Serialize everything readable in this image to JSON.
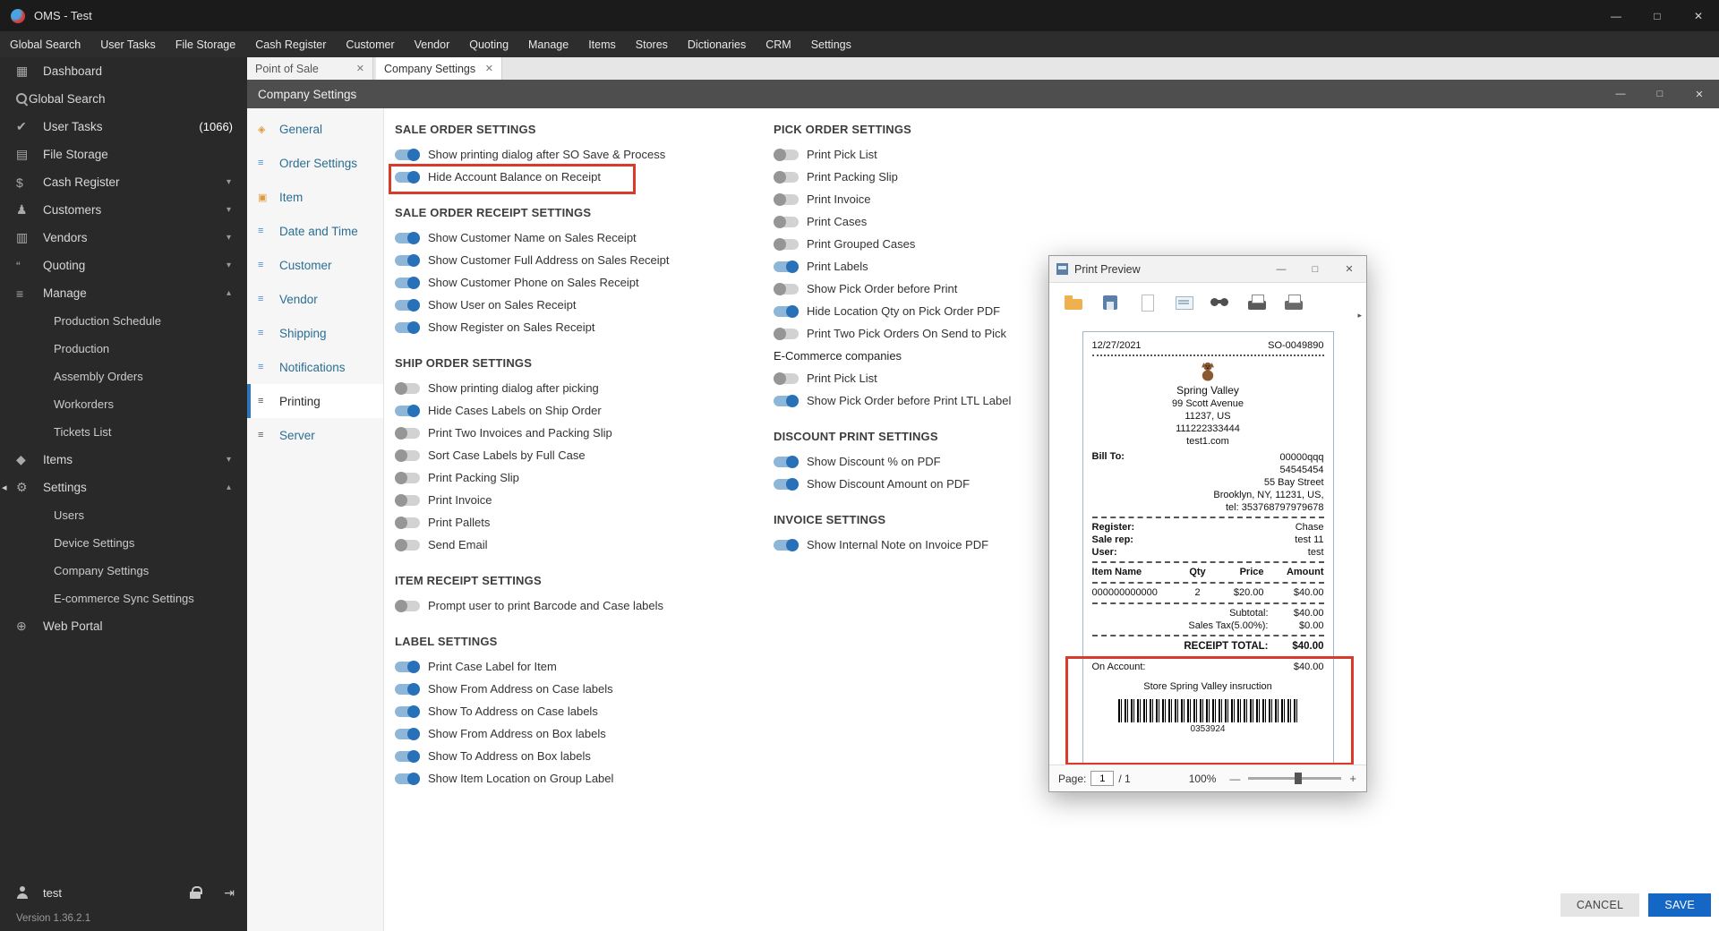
{
  "colors": {
    "accent_blue": "#2e75b6",
    "toggle_on_track": "#8db6d8",
    "toggle_on_knob": "#2871b8",
    "toggle_off_track": "#d2d2d2",
    "toggle_off_knob": "#969696",
    "annotation_red": "#d83a2b",
    "save_button_blue": "#1467c5"
  },
  "glyphs": {
    "minimize": "—",
    "maximize": "□",
    "close": "✕",
    "chevron_down": "▾",
    "chevron_up": "▴",
    "marker_left": "◂",
    "overflow": "▸",
    "logout": "⇥"
  },
  "titlebar": {
    "title": "OMS - Test"
  },
  "menubar": {
    "items": [
      "Global Search",
      "User Tasks",
      "File Storage",
      "Cash Register",
      "Customer",
      "Vendor",
      "Quoting",
      "Manage",
      "Items",
      "Stores",
      "Dictionaries",
      "CRM",
      "Settings"
    ]
  },
  "sidebar": {
    "items": [
      {
        "label": "Dashboard",
        "icon": "dashboard-icon",
        "glyph": "▦"
      },
      {
        "label": "Global Search",
        "icon": "search-icon",
        "glyph": "mag"
      },
      {
        "label": "User Tasks",
        "icon": "tasks-icon",
        "glyph": "✔",
        "count": "(1066)"
      },
      {
        "label": "File Storage",
        "icon": "file-storage-icon",
        "glyph": "▤"
      },
      {
        "label": "Cash Register",
        "icon": "cash-register-icon",
        "glyph": "$",
        "chevron": "down"
      },
      {
        "label": "Customers",
        "icon": "customers-icon",
        "glyph": "♟",
        "chevron": "down"
      },
      {
        "label": "Vendors",
        "icon": "vendors-icon",
        "glyph": "▥",
        "chevron": "down"
      },
      {
        "label": "Quoting",
        "icon": "quoting-icon",
        "glyph": "“",
        "chevron": "down"
      },
      {
        "label": "Manage",
        "icon": "manage-icon",
        "glyph": "≡",
        "chevron": "up"
      },
      {
        "label": "Production Schedule",
        "sub": true
      },
      {
        "label": "Production",
        "sub": true
      },
      {
        "label": "Assembly Orders",
        "sub": true
      },
      {
        "label": "Workorders",
        "sub": true
      },
      {
        "label": "Tickets List",
        "sub": true
      },
      {
        "label": "Items",
        "icon": "items-icon",
        "glyph": "◆",
        "chevron": "down"
      },
      {
        "label": "Settings",
        "icon": "gear-icon",
        "glyph": "⚙",
        "chevron": "up",
        "marker": true
      },
      {
        "label": "Users",
        "sub": true
      },
      {
        "label": "Device Settings",
        "sub": true
      },
      {
        "label": "Company Settings",
        "sub": true
      },
      {
        "label": "E-commerce Sync Settings",
        "sub": true
      },
      {
        "label": "Web Portal",
        "icon": "web-portal-icon",
        "glyph": "⊕"
      }
    ],
    "user": "test",
    "version": "Version 1.36.2.1"
  },
  "tabs": [
    {
      "label": "Point of Sale"
    },
    {
      "label": "Company Settings",
      "active": true
    }
  ],
  "settings_window": {
    "title": "Company Settings"
  },
  "settings_nav": [
    {
      "label": "General",
      "glyph": "◈",
      "color": "#e09a3e"
    },
    {
      "label": "Order Settings",
      "glyph": "≡",
      "color": "#4a90d9"
    },
    {
      "label": "Item",
      "glyph": "▣",
      "color": "#e09a3e"
    },
    {
      "label": "Date and Time",
      "glyph": "≡",
      "color": "#4a90d9"
    },
    {
      "label": "Customer",
      "glyph": "≡",
      "color": "#4a90d9"
    },
    {
      "label": "Vendor",
      "glyph": "≡",
      "color": "#4a90d9"
    },
    {
      "label": "Shipping",
      "glyph": "≡",
      "color": "#4a90d9"
    },
    {
      "label": "Notifications",
      "glyph": "≡",
      "color": "#4a90d9"
    },
    {
      "label": "Printing",
      "glyph": "≡",
      "color": "#555555",
      "selected": true
    },
    {
      "label": "Server",
      "glyph": "≡",
      "color": "#555555"
    }
  ],
  "settings_columns": [
    {
      "sections": [
        {
          "title": "SALE ORDER SETTINGS",
          "items": [
            {
              "label": "Show printing dialog after SO Save & Process",
              "on": true
            },
            {
              "label": "Hide Account Balance on Receipt",
              "on": true,
              "highlight": true
            }
          ]
        },
        {
          "title": "SALE ORDER RECEIPT SETTINGS",
          "items": [
            {
              "label": "Show Customer Name on Sales Receipt",
              "on": true
            },
            {
              "label": "Show Customer Full Address on Sales Receipt",
              "on": true
            },
            {
              "label": "Show Customer Phone on Sales Receipt",
              "on": true
            },
            {
              "label": "Show User on Sales Receipt",
              "on": true
            },
            {
              "label": "Show Register on Sales Receipt",
              "on": true
            }
          ]
        },
        {
          "title": "SHIP ORDER SETTINGS",
          "items": [
            {
              "label": "Show printing dialog after picking",
              "on": false
            },
            {
              "label": "Hide Cases Labels on Ship Order",
              "on": true
            },
            {
              "label": "Print Two Invoices and Packing Slip",
              "on": false
            },
            {
              "label": "Sort Case Labels by Full Case",
              "on": false
            },
            {
              "label": "Print Packing Slip",
              "on": false
            },
            {
              "label": "Print Invoice",
              "on": false
            },
            {
              "label": "Print Pallets",
              "on": false
            },
            {
              "label": "Send Email",
              "on": false
            }
          ]
        },
        {
          "title": "ITEM RECEIPT SETTINGS",
          "items": [
            {
              "label": "Prompt user to print Barcode and Case labels",
              "on": false
            }
          ]
        },
        {
          "title": "LABEL SETTINGS",
          "items": [
            {
              "label": "Print Case Label for Item",
              "on": true
            },
            {
              "label": "Show From Address on Case labels",
              "on": true
            },
            {
              "label": "Show To Address on Case labels",
              "on": true
            },
            {
              "label": "Show From Address on Box labels",
              "on": true
            },
            {
              "label": "Show To Address on Box labels",
              "on": true
            },
            {
              "label": "Show Item Location on Group Label",
              "on": true
            }
          ]
        }
      ]
    },
    {
      "sections": [
        {
          "title": "PICK ORDER SETTINGS",
          "items": [
            {
              "label": "Print Pick List",
              "on": false
            },
            {
              "label": "Print Packing Slip",
              "on": false
            },
            {
              "label": "Print Invoice",
              "on": false
            },
            {
              "label": "Print Cases",
              "on": false
            },
            {
              "label": "Print Grouped Cases",
              "on": false
            },
            {
              "label": "Print Labels",
              "on": true
            },
            {
              "label": "Show Pick Order before Print",
              "on": false
            },
            {
              "label": "Hide Location Qty on Pick Order PDF",
              "on": true
            },
            {
              "label": "Print Two Pick Orders On Send to Pick",
              "on": false
            },
            {
              "label": "E-Commerce companies",
              "subheader": true
            },
            {
              "label": "Print Pick List",
              "on": false
            },
            {
              "label": "Show Pick Order before Print LTL Label",
              "on": true
            }
          ]
        },
        {
          "title": "DISCOUNT PRINT SETTINGS",
          "items": [
            {
              "label": "Show Discount % on PDF",
              "on": true
            },
            {
              "label": "Show Discount Amount on PDF",
              "on": true
            }
          ]
        },
        {
          "title": "INVOICE SETTINGS",
          "items": [
            {
              "label": "Show Internal Note on Invoice PDF",
              "on": true
            }
          ]
        }
      ]
    }
  ],
  "print_preview": {
    "title": "Print Preview",
    "receipt": {
      "date": "12/27/2021",
      "order_no": "SO-0049890",
      "store_name": "Spring Valley",
      "store_address1": "99 Scott Avenue",
      "store_address2": "11237, US",
      "store_phone": "111222333444",
      "store_site": "test1.com",
      "bill_to_label": "Bill To:",
      "bill_to_lines": [
        "00000qqq",
        "54545454",
        "55 Bay Street",
        "Brooklyn, NY, 11231, US,",
        "tel: 353768797979678"
      ],
      "register_label": "Register:",
      "register_value": "Chase",
      "salerep_label": "Sale rep:",
      "salerep_value": "test 11",
      "user_label": "User:",
      "user_value": "test",
      "table": {
        "headers": [
          "Item Name",
          "Qty",
          "Price",
          "Amount"
        ],
        "rows": [
          [
            "000000000000",
            "2",
            "$20.00",
            "$40.00"
          ]
        ]
      },
      "subtotal_label": "Subtotal:",
      "subtotal_value": "$40.00",
      "tax_label": "Sales Tax(5.00%):",
      "tax_value": "$0.00",
      "total_label": "RECEIPT TOTAL:",
      "total_value": "$40.00",
      "on_account_label": "On Account:",
      "on_account_value": "$40.00",
      "note": "Store Spring Valley insruction",
      "barcode_number": "0353924"
    },
    "pagination": {
      "page_label": "Page:",
      "page_value": "1",
      "page_total": "/ 1",
      "zoom_label": "100%",
      "minus": "—",
      "plus": "+"
    }
  },
  "footer": {
    "cancel_label": "CANCEL",
    "save_label": "SAVE"
  }
}
